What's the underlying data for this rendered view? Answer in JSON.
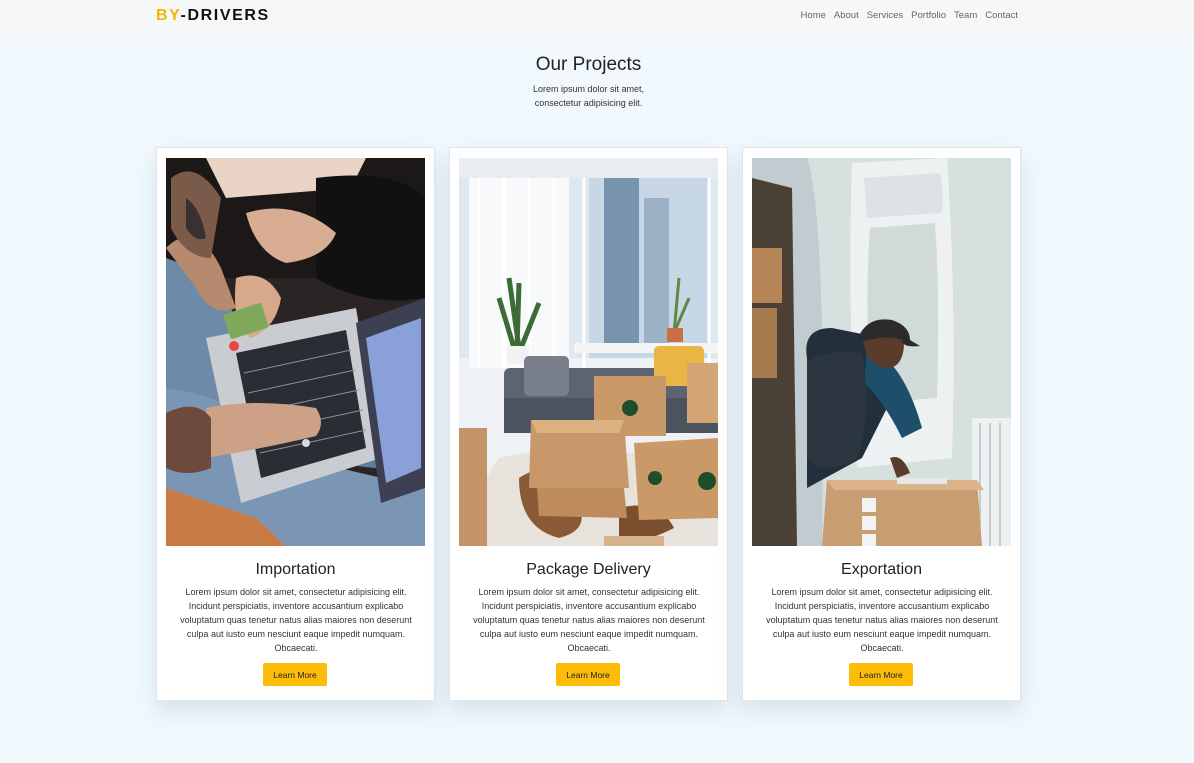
{
  "brand": {
    "accent": "BY",
    "rest": "-DRIVERS",
    "accent_color": "#f5b600"
  },
  "nav": {
    "items": [
      "Home",
      "About",
      "Services",
      "Portfolio",
      "Team",
      "Contact"
    ]
  },
  "section": {
    "title": "Our Projects",
    "subtitle_line1": "Lorem ipsum dolor sit amet,",
    "subtitle_line2": "consectetur adipisicing elit."
  },
  "cards": [
    {
      "title": "Importation",
      "text": "Lorem ipsum dolor sit amet, consectetur adipisicing elit. Incidunt perspiciatis, inventore accusantium explicabo voluptatum quas tenetur natus alias maiores non deserunt culpa aut iusto eum nesciunt eaque impedit numquam. Obcaecati.",
      "button": "Learn More"
    },
    {
      "title": "Package Delivery",
      "text": "Lorem ipsum dolor sit amet, consectetur adipisicing elit. Incidunt perspiciatis, inventore accusantium explicabo voluptatum quas tenetur natus alias maiores non deserunt culpa aut iusto eum nesciunt eaque impedit numquam. Obcaecati.",
      "button": "Learn More"
    },
    {
      "title": "Exportation",
      "text": "Lorem ipsum dolor sit amet, consectetur adipisicing elit. Incidunt perspiciatis, inventore accusantium explicabo voluptatum quas tenetur natus alias maiores non deserunt culpa aut iusto eum nesciunt eaque impedit numquam. Obcaecati.",
      "button": "Learn More"
    }
  ],
  "colors": {
    "page_bg": "#f1f9fe",
    "button_bg": "#fcbc08",
    "navbar_bg": "#f5f7f9"
  }
}
